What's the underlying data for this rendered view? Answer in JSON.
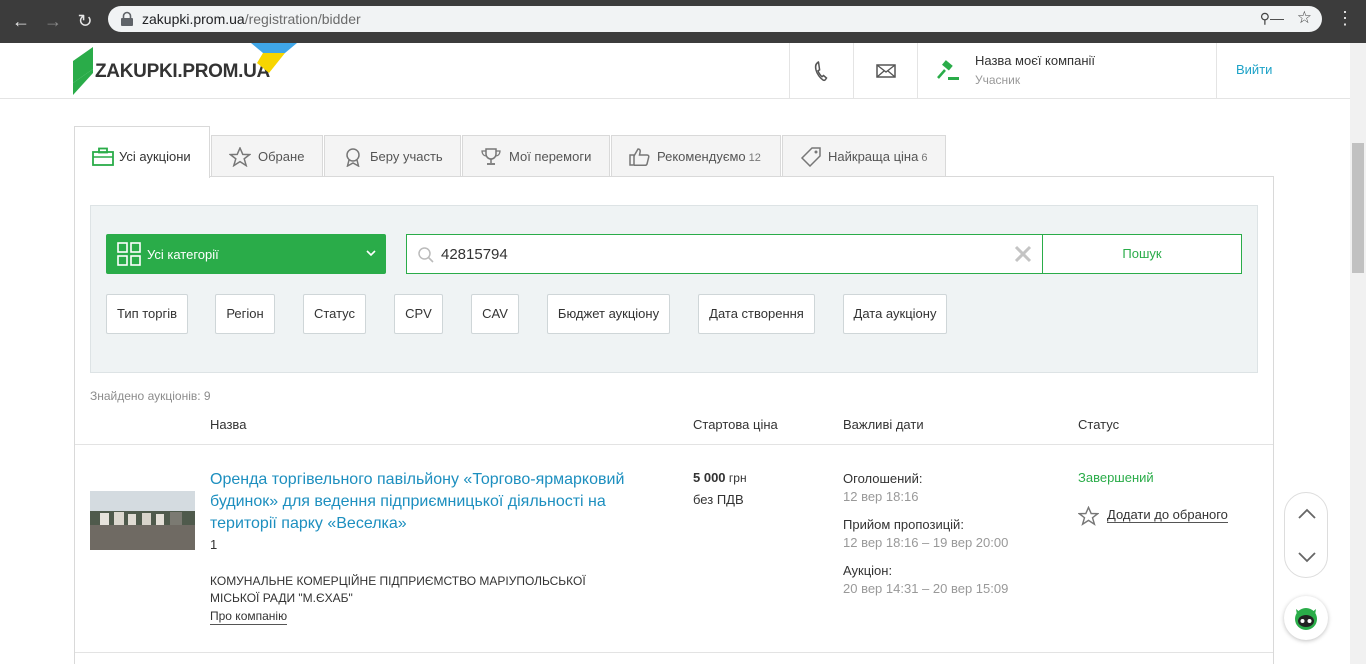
{
  "browser": {
    "url_host": "zakupki.prom.ua",
    "url_path": "/registration/bidder"
  },
  "header": {
    "logo_text": "ZAKUPKI.PROM.UA",
    "company_name": "Назва моєї компанії",
    "company_role": "Учасник",
    "logout_label": "Вийти"
  },
  "tabs": [
    {
      "label": "Усі аукціони",
      "count": ""
    },
    {
      "label": "Обране",
      "count": ""
    },
    {
      "label": "Беру участь",
      "count": ""
    },
    {
      "label": "Мої перемоги",
      "count": ""
    },
    {
      "label": "Рекомендуємо",
      "count": "12"
    },
    {
      "label": "Найкраща ціна",
      "count": "6"
    }
  ],
  "filters": {
    "category_label": "Усі категорії",
    "search_value": "42815794",
    "search_button": "Пошук",
    "chips": [
      "Тип торгів",
      "Регіон",
      "Статус",
      "CPV",
      "CAV",
      "Бюджет аукціону",
      "Дата створення",
      "Дата аукціону"
    ]
  },
  "results": {
    "found_text": "Знайдено аукціонів: 9",
    "columns": [
      "Назва",
      "Стартова ціна",
      "Важливі дати",
      "Статус"
    ],
    "items": [
      {
        "title": "Оренда торгівельного павільйону «Торгово-ярмарковий будинок» для ведення підприємницької діяльності на території парку «Веселка»",
        "lot": "1",
        "organization": "КОМУНАЛЬНЕ КОМЕРЦІЙНЕ ПІДПРИЄМСТВО МАРІУПОЛЬСЬКОЇ МІСЬКОЇ РАДИ \"М.ЄХАБ\"",
        "org_link": "Про компанію",
        "price_amount": "5 000",
        "price_currency": "грн",
        "price_vat": "без ПДВ",
        "dates": [
          {
            "label": "Оголошений:",
            "value": "12 вер 18:16"
          },
          {
            "label": "Прийом пропозицій:",
            "value": "12 вер 18:16 – 19 вер 20:00"
          },
          {
            "label": "Аукціон:",
            "value": "20 вер 14:31 – 20 вер 15:09"
          }
        ],
        "status": "Завершений",
        "favorite_label": "Додати до обраного"
      }
    ]
  },
  "colors": {
    "brand_green": "#2aac49",
    "link_blue": "#1d8fbf"
  }
}
